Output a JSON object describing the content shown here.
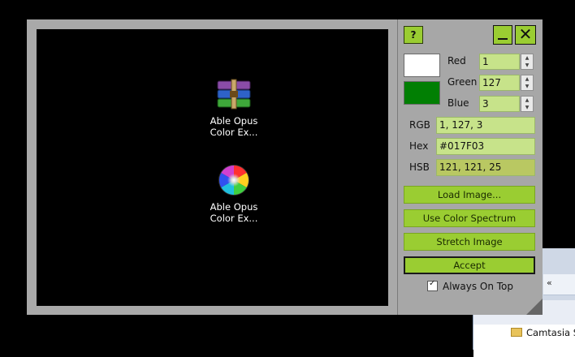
{
  "viewer": {
    "icons": [
      {
        "label_line1": "Able Opus",
        "label_line2": "Color Ex...",
        "icon": "winrar-archive-icon"
      },
      {
        "label_line1": "Able Opus",
        "label_line2": "Color Ex...",
        "icon": "color-sphere-icon"
      }
    ]
  },
  "panel": {
    "help_label": "?",
    "close_label": "✕",
    "colors": {
      "primary_swatch": "#FFFFFF",
      "secondary_swatch": "#017F03",
      "accent": "#9ACD32"
    },
    "red": {
      "label": "Red",
      "value": "1"
    },
    "green": {
      "label": "Green",
      "value": "127"
    },
    "blue": {
      "label": "Blue",
      "value": "3"
    },
    "rgb": {
      "label": "RGB",
      "value": "1, 127, 3"
    },
    "hex": {
      "label": "Hex",
      "value": "#017F03"
    },
    "hsb": {
      "label": "HSB",
      "value": "121, 121, 25"
    },
    "buttons": {
      "load_image": "Load Image...",
      "use_spectrum": "Use Color Spectrum",
      "stretch_image": "Stretch Image",
      "accept": "Accept"
    },
    "always_on_top": {
      "label": "Always On Top",
      "checked": true
    }
  },
  "background_window": {
    "back_label": "«",
    "folder_item": "Camtasia St"
  }
}
